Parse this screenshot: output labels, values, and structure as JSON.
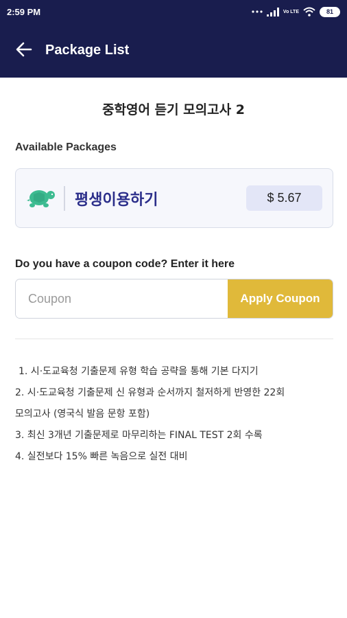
{
  "status_bar": {
    "time": "2:59 PM",
    "battery": "81",
    "network_label": "Vo LTE",
    "icons": [
      "dots-icon",
      "signal-icon",
      "volte-icon",
      "wifi-icon",
      "battery-icon"
    ]
  },
  "app_bar": {
    "title": "Package List",
    "back_icon": "arrow-left-icon"
  },
  "course": {
    "title": "중학영어 듣기 모의고사 2"
  },
  "packages": {
    "section_label": "Available Packages",
    "items": [
      {
        "name": "평생이용하기",
        "price": "$ 5.67",
        "icon": "turtle-icon"
      }
    ]
  },
  "coupon": {
    "label": "Do you have a coupon code? Enter it here",
    "placeholder": "Coupon",
    "value": "",
    "button_label": "Apply Coupon"
  },
  "features": [
    "1. 시·도교육청 기출문제 유형 학습 공략을 통해 기본 다지기",
    "2. 시·도교육청 기출문제 신 유형과 순서까지 철저하게 반영한 22회",
    "모의고사 (영국식 발음 문항 포함)",
    "3. 최신 3개년 기출문제로 마무리하는 FINAL TEST 2회 수록",
    "4. 실전보다 15% 빠른 녹음으로 실전 대비"
  ],
  "colors": {
    "header": "#191d4e",
    "accent_gold": "#e0b93a",
    "package_text": "#2b2e8a",
    "turtle": "#3dbb91"
  }
}
